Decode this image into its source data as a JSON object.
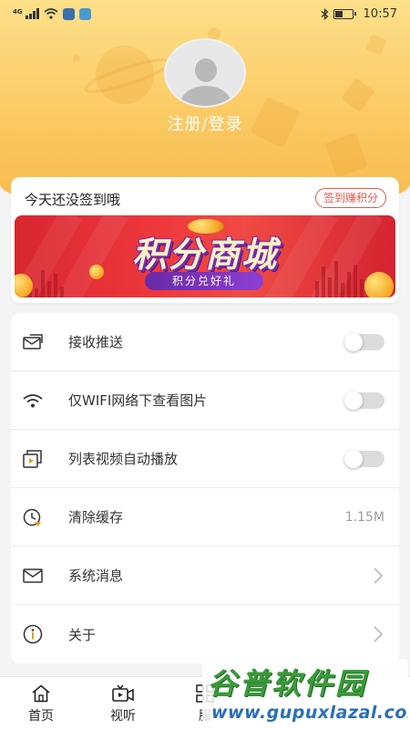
{
  "status_bar": {
    "network": "4G",
    "time": "10:57"
  },
  "profile": {
    "login_label": "注册/登录",
    "avatar_icon": "default-user-avatar"
  },
  "sign_in": {
    "prompt": "今天还没签到哦",
    "button_label": "签到赚积分",
    "banner_title": "积分商城",
    "banner_subtitle": "积分兑好礼"
  },
  "settings": {
    "items": [
      {
        "icon": "envelope-notification-icon",
        "label": "接收推送",
        "control": "toggle",
        "on": false
      },
      {
        "icon": "wifi-icon",
        "label": "仅WIFI网络下查看图片",
        "control": "toggle",
        "on": false
      },
      {
        "icon": "video-play-icon",
        "label": "列表视频自动播放",
        "control": "toggle",
        "on": false
      },
      {
        "icon": "clock-clear-icon",
        "label": "清除缓存",
        "control": "value",
        "value": "1.15M"
      },
      {
        "icon": "mail-icon",
        "label": "系统消息",
        "control": "chevron"
      },
      {
        "icon": "info-icon",
        "label": "关于",
        "control": "chevron"
      }
    ]
  },
  "bottom_nav": {
    "items": [
      {
        "icon": "home-icon",
        "label": "首页"
      },
      {
        "icon": "video-icon",
        "label": "视听"
      },
      {
        "icon": "grid-icon",
        "label": "服"
      }
    ]
  },
  "watermark": {
    "title": "谷普软件园",
    "url": "www.gupuxlazal.com"
  },
  "colors": {
    "header_top": "#fde08a",
    "header_bottom": "#f9b94d",
    "accent_red": "#e05b4c",
    "banner_red": "#ef3a3d"
  }
}
